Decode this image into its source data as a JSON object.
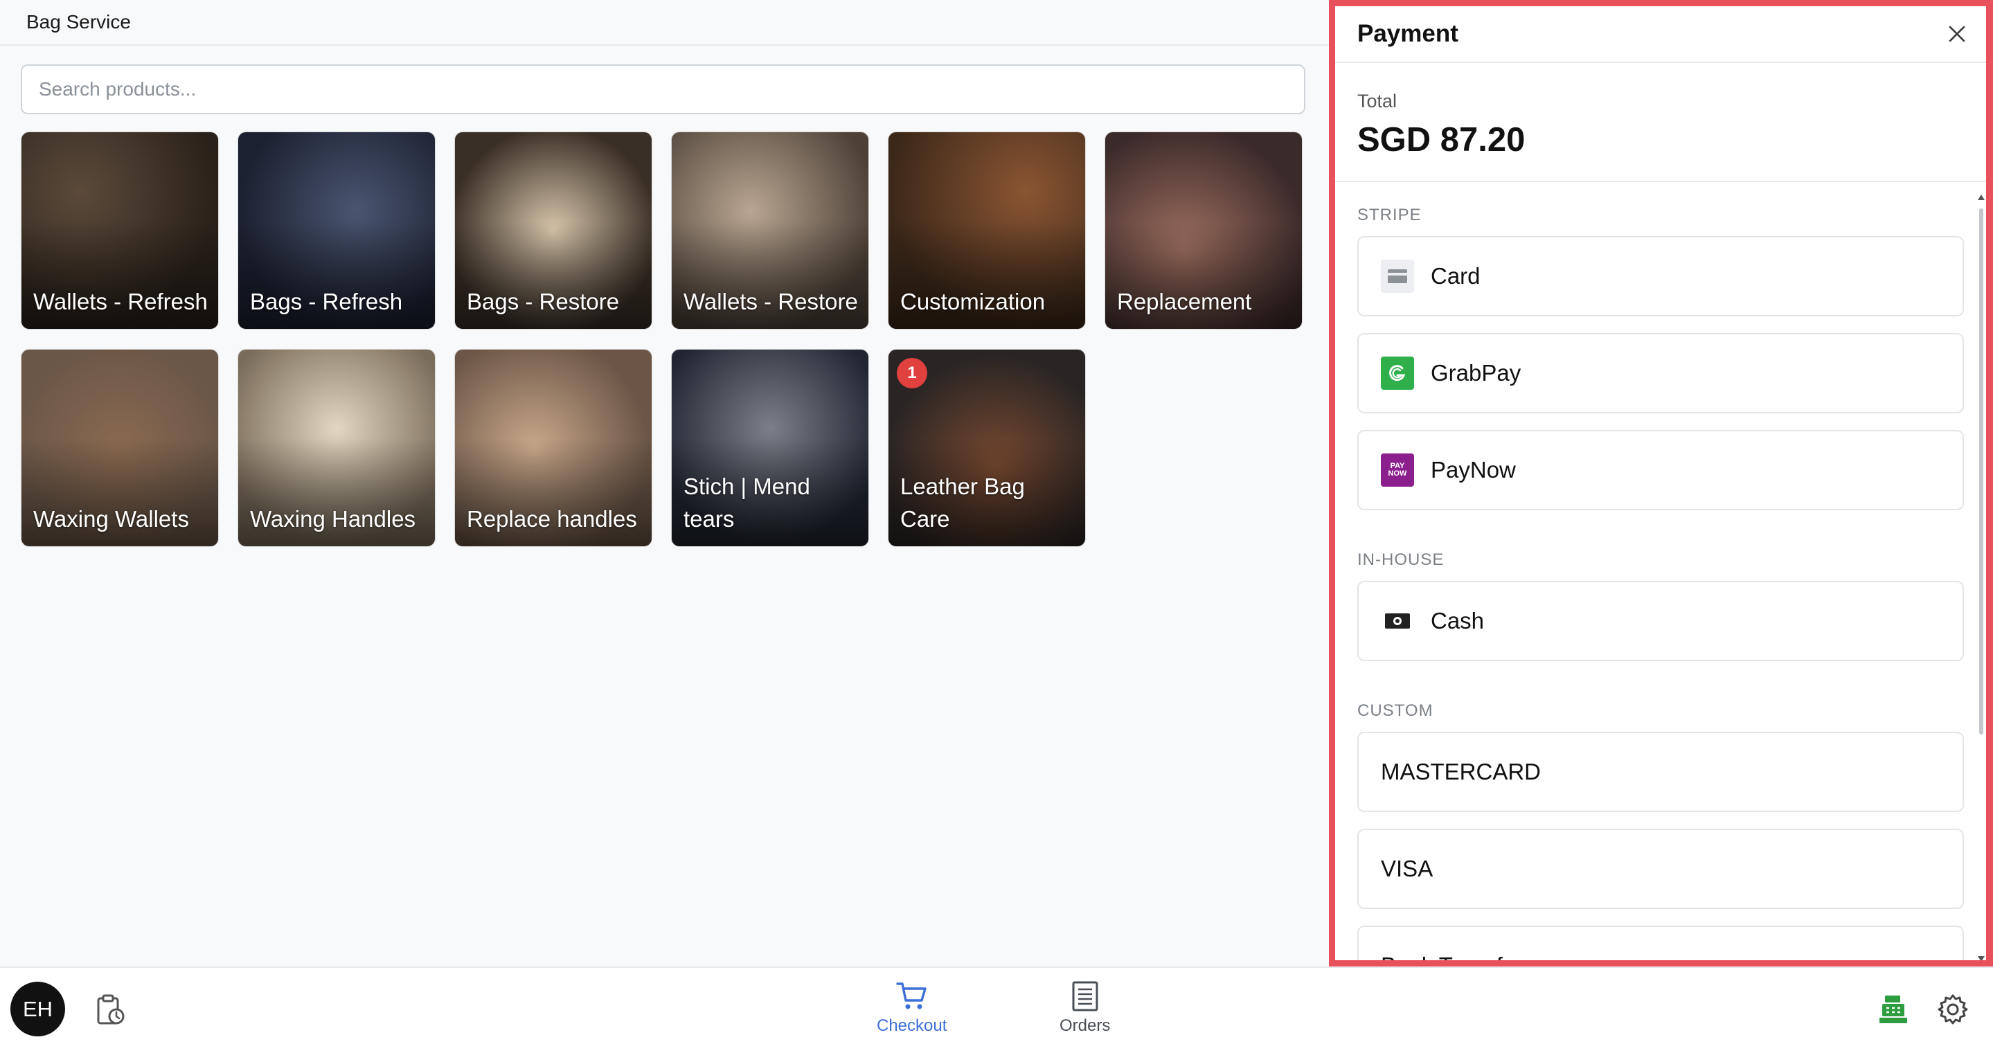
{
  "app": {
    "title": "Bag Service"
  },
  "search": {
    "placeholder": "Search products..."
  },
  "products": [
    {
      "label": "Wallets - Refresh"
    },
    {
      "label": "Bags - Refresh"
    },
    {
      "label": "Bags - Restore"
    },
    {
      "label": "Wallets - Restore"
    },
    {
      "label": "Customization"
    },
    {
      "label": "Replacement"
    },
    {
      "label": "Waxing Wallets"
    },
    {
      "label": "Waxing Handles"
    },
    {
      "label": "Replace handles"
    },
    {
      "label": "Stich | Mend tears"
    },
    {
      "label": "Leather Bag Care",
      "badge": "1"
    }
  ],
  "payment": {
    "title": "Payment",
    "total_label": "Total",
    "total_value": "SGD 87.20",
    "sections": {
      "stripe": "STRIPE",
      "inhouse": "IN-HOUSE",
      "custom": "CUSTOM"
    },
    "stripe_methods": [
      {
        "label": "Card",
        "icon": "card-icon"
      },
      {
        "label": "GrabPay",
        "icon": "grabpay-icon"
      },
      {
        "label": "PayNow",
        "icon": "paynow-icon",
        "icon_text": "PAY NOW"
      }
    ],
    "inhouse_methods": [
      {
        "label": "Cash",
        "icon": "cash-icon"
      }
    ],
    "custom_methods": [
      {
        "label": "MASTERCARD"
      },
      {
        "label": "VISA"
      },
      {
        "label": "Bank Transfer"
      }
    ]
  },
  "bottom": {
    "avatar_initials": "EH",
    "nav": [
      {
        "label": "Checkout",
        "icon": "cart-icon",
        "active": true
      },
      {
        "label": "Orders",
        "icon": "orders-icon",
        "active": false
      }
    ]
  },
  "colors": {
    "accent": "#3d6fd8",
    "highlight_border": "#e8505b",
    "badge": "#e0413e",
    "register_green": "#2e9d3f"
  }
}
